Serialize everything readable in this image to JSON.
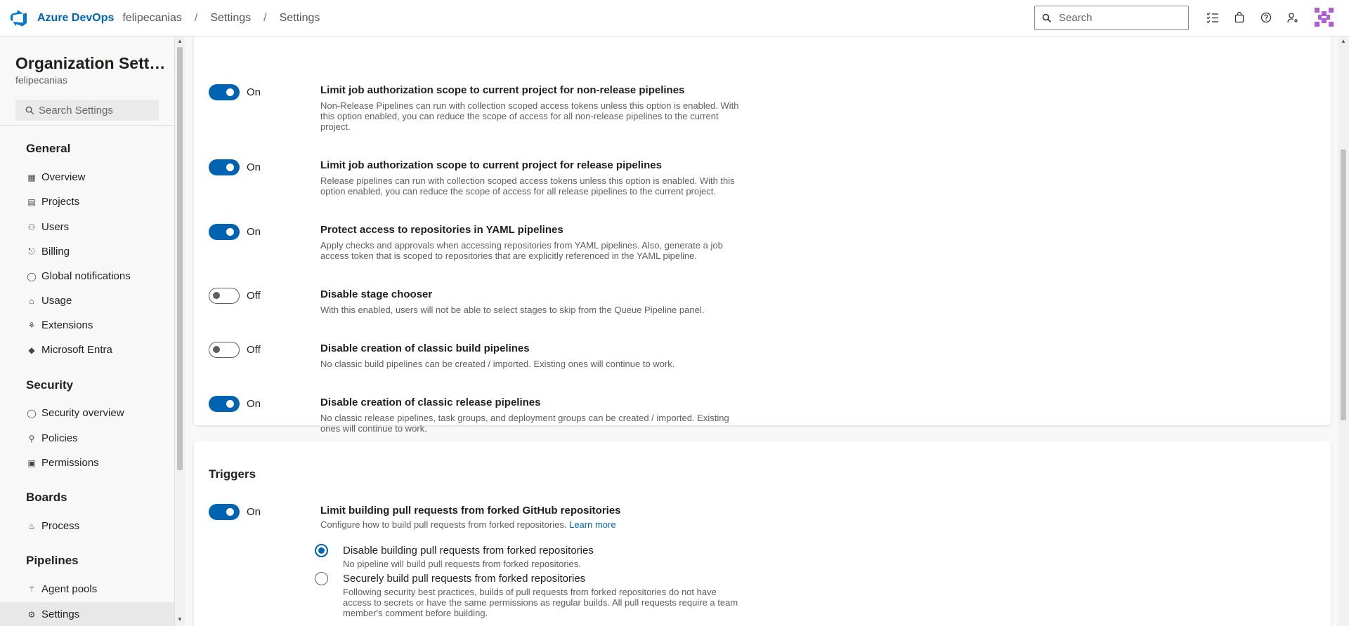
{
  "header": {
    "brand": "Azure DevOps",
    "breadcrumbs": [
      "felipecanias",
      "Settings",
      "Settings"
    ],
    "separator": "/",
    "search_placeholder": "Search",
    "icons": [
      "task-list-icon",
      "marketplace-bag-icon",
      "help-icon",
      "user-settings-icon"
    ]
  },
  "sidebar": {
    "title": "Organization Settings",
    "subtitle": "felipecanias",
    "search_placeholder": "Search Settings",
    "groups": {
      "general": {
        "label": "General",
        "items": [
          {
            "label": "Overview",
            "icon": "overview-icon"
          },
          {
            "label": "Projects",
            "icon": "projects-icon"
          },
          {
            "label": "Users",
            "icon": "users-icon"
          },
          {
            "label": "Billing",
            "icon": "billing-icon"
          },
          {
            "label": "Global notifications",
            "icon": "notifications-icon"
          },
          {
            "label": "Usage",
            "icon": "usage-icon"
          },
          {
            "label": "Extensions",
            "icon": "extensions-icon"
          },
          {
            "label": "Microsoft Entra",
            "icon": "entra-icon"
          }
        ]
      },
      "security": {
        "label": "Security",
        "items": [
          {
            "label": "Security overview",
            "icon": "shield-icon"
          },
          {
            "label": "Policies",
            "icon": "policy-icon"
          },
          {
            "label": "Permissions",
            "icon": "lock-icon"
          }
        ]
      },
      "boards": {
        "label": "Boards",
        "items": [
          {
            "label": "Process",
            "icon": "process-icon"
          }
        ]
      },
      "pipelines": {
        "label": "Pipelines",
        "items": [
          {
            "label": "Agent pools",
            "icon": "agent-pools-icon"
          },
          {
            "label": "Settings",
            "icon": "gear-icon",
            "selected": true
          }
        ]
      }
    }
  },
  "general_settings": [
    {
      "state": "On",
      "enabled": true,
      "title": "Limit job authorization scope to current project for non-release pipelines",
      "description": "Non-Release Pipelines can run with collection scoped access tokens unless this option is enabled. With this option enabled, you can reduce the scope of access for all non-release pipelines to the current project."
    },
    {
      "state": "On",
      "enabled": true,
      "title": "Limit job authorization scope to current project for release pipelines",
      "description": "Release pipelines can run with collection scoped access tokens unless this option is enabled. With this option enabled, you can reduce the scope of access for all release pipelines to the current project."
    },
    {
      "state": "On",
      "enabled": true,
      "title": "Protect access to repositories in YAML pipelines",
      "description": "Apply checks and approvals when accessing repositories from YAML pipelines. Also, generate a job access token that is scoped to repositories that are explicitly referenced in the YAML pipeline."
    },
    {
      "state": "Off",
      "enabled": false,
      "title": "Disable stage chooser",
      "description": "With this enabled, users will not be able to select stages to skip from the Queue Pipeline panel."
    },
    {
      "state": "Off",
      "enabled": false,
      "title": "Disable creation of classic build pipelines",
      "description": "No classic build pipelines can be created / imported. Existing ones will continue to work."
    },
    {
      "state": "On",
      "enabled": true,
      "title": "Disable creation of classic release pipelines",
      "description": "No classic release pipelines, task groups, and deployment groups can be created / imported. Existing ones will continue to work."
    }
  ],
  "triggers": {
    "title": "Triggers",
    "setting": {
      "state": "On",
      "enabled": true,
      "title": "Limit building pull requests from forked GitHub repositories",
      "description": "Configure how to build pull requests from forked repositories.",
      "link": "Learn more"
    },
    "options": [
      {
        "label": "Disable building pull requests from forked repositories",
        "description": "No pipeline will build pull requests from forked repositories.",
        "selected": true
      },
      {
        "label": "Securely build pull requests from forked repositories",
        "description": "Following security best practices, builds of pull requests from forked repositories do not have access to secrets or have the same permissions as regular builds. All pull requests require a team member's comment before building.",
        "selected": false
      }
    ]
  },
  "colors": {
    "accent": "#0063b1",
    "toggle_on": "#0063b1",
    "toggle_off_border": "#605e5c"
  }
}
